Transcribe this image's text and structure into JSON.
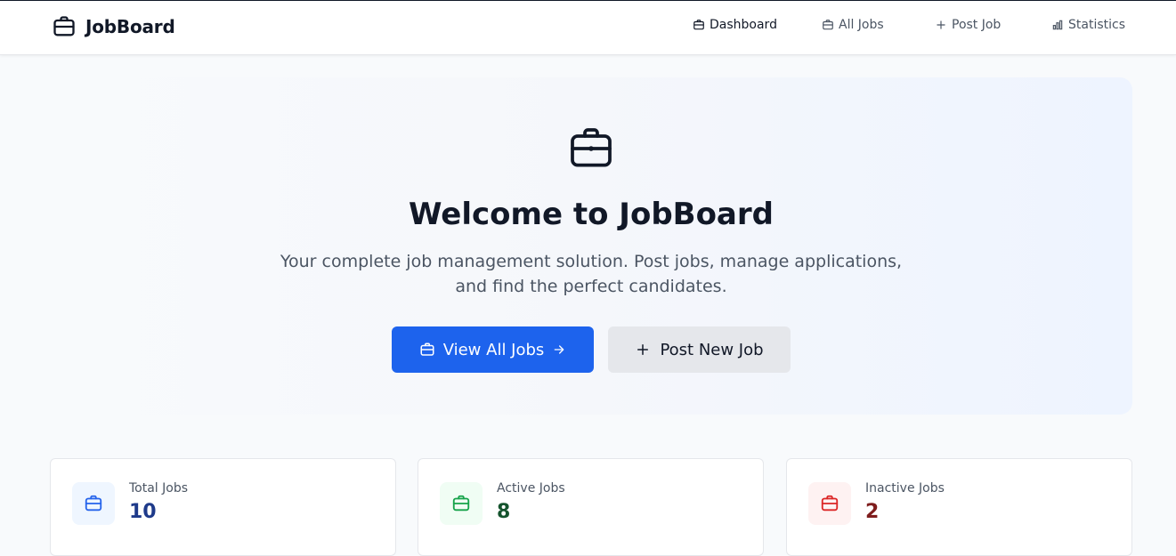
{
  "app": {
    "name": "JobBoard",
    "icon": "briefcase-icon"
  },
  "nav": {
    "items": [
      {
        "label": "Dashboard",
        "icon": "briefcase-icon",
        "active": true
      },
      {
        "label": "All Jobs",
        "icon": "briefcase-icon",
        "active": false
      },
      {
        "label": "Post Job",
        "icon": "plus-icon",
        "active": false
      },
      {
        "label": "Statistics",
        "icon": "bar-chart-icon",
        "active": false
      }
    ]
  },
  "hero": {
    "icon": "briefcase-icon",
    "title": "Welcome to JobBoard",
    "subtitle": "Your complete job management solution. Post jobs, manage applications, and find the perfect candidates.",
    "primary_button": {
      "label": "View All Jobs",
      "icon": "briefcase-icon",
      "trailing_icon": "arrow-right-icon"
    },
    "secondary_button": {
      "label": "Post New Job",
      "icon": "plus-icon"
    }
  },
  "stats": [
    {
      "label": "Total Jobs",
      "value": "10",
      "color": "#1e3a8a",
      "icon_color": "#2563eb",
      "icon_bg": "#eff6ff"
    },
    {
      "label": "Active Jobs",
      "value": "8",
      "color": "#14532d",
      "icon_color": "#16a34a",
      "icon_bg": "#f0fdf4"
    },
    {
      "label": "Inactive Jobs",
      "value": "2",
      "color": "#7f1d1d",
      "icon_color": "#dc2626",
      "icon_bg": "#fef2f2"
    }
  ],
  "colors": {
    "accent": "#1d63ed",
    "secondary_button": "#e5e7eb"
  }
}
